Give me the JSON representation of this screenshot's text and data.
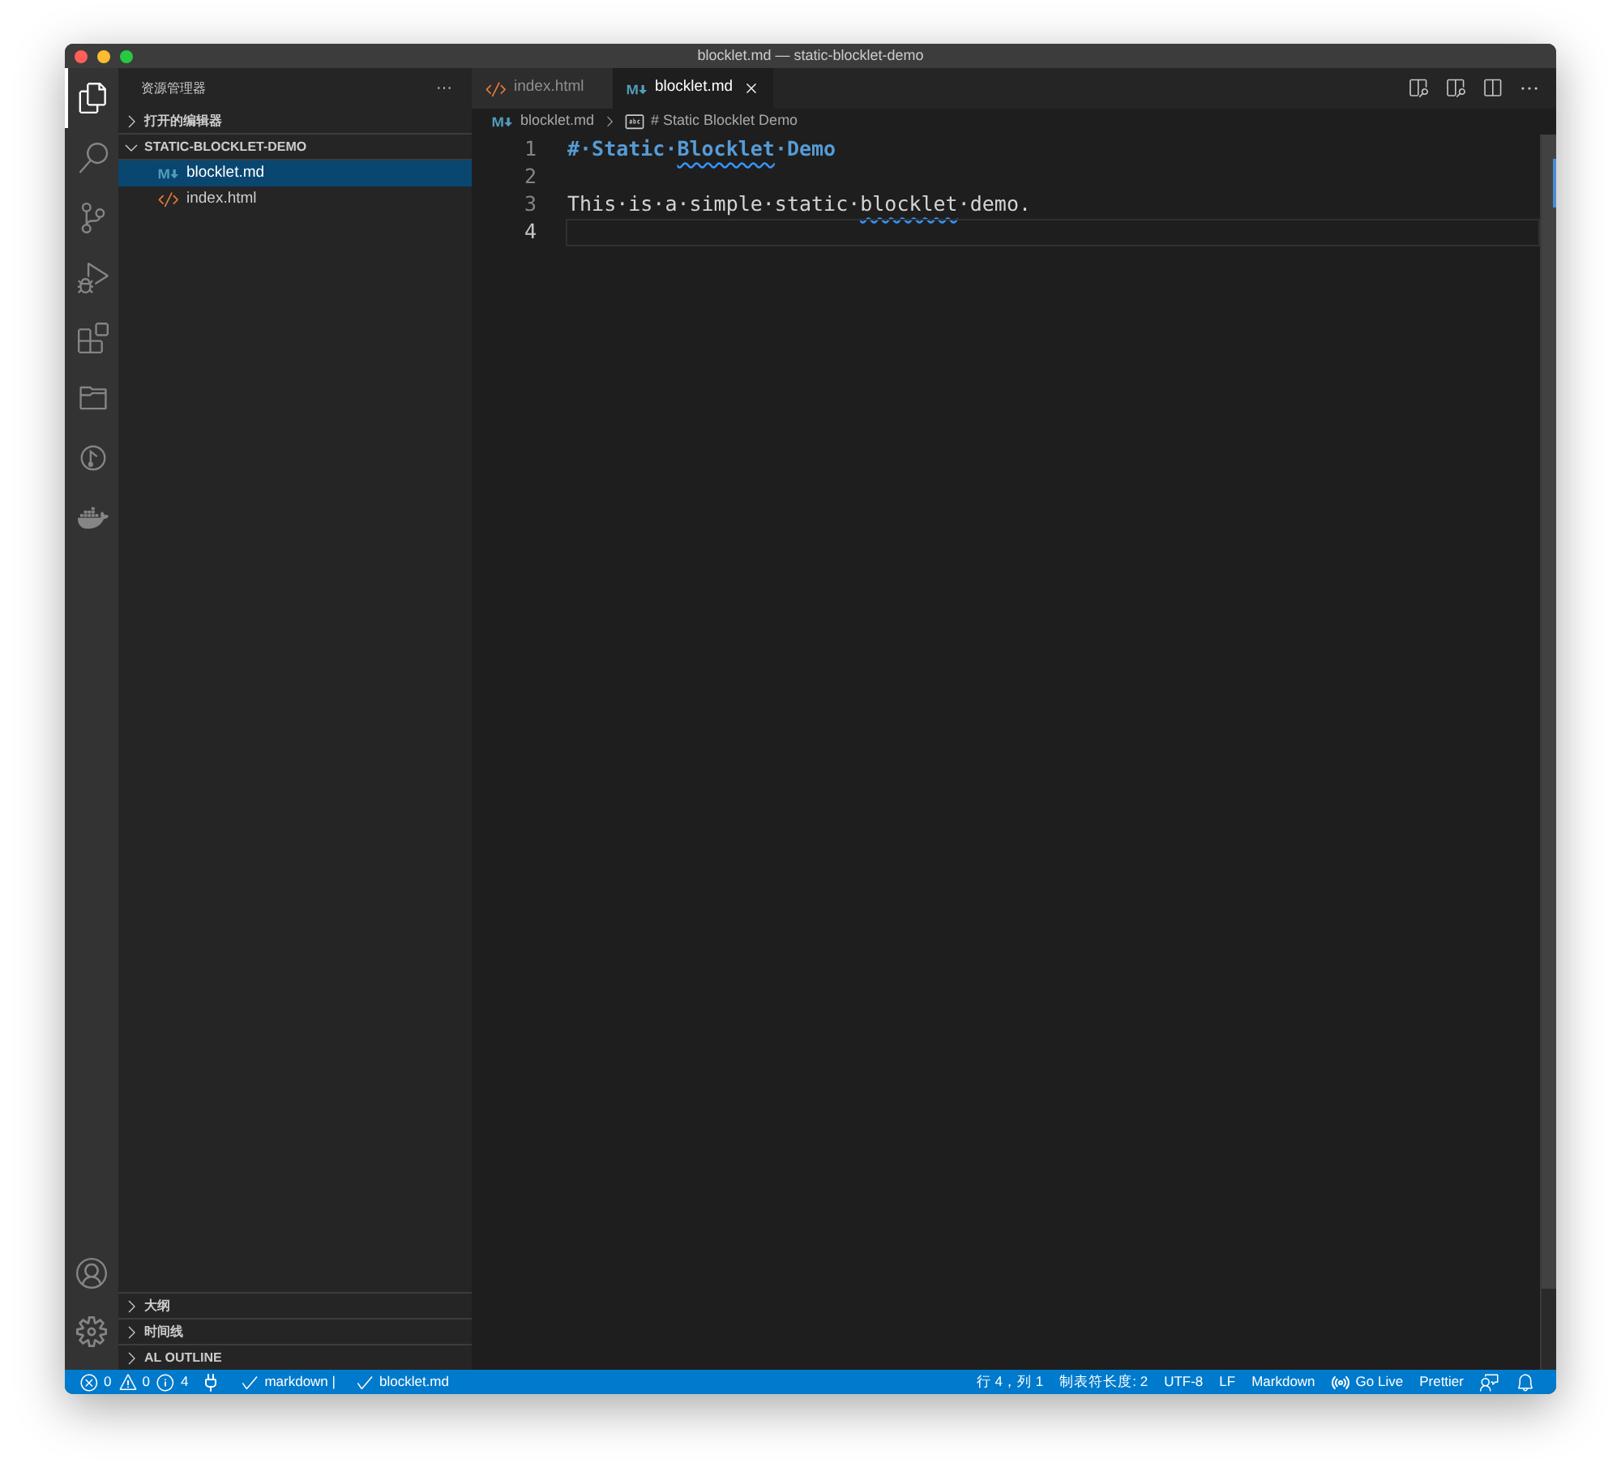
{
  "window": {
    "title": "blocklet.md — static-blocklet-demo"
  },
  "activity_bar": [
    {
      "kind": "files",
      "selected": true
    },
    {
      "kind": "search",
      "selected": false
    },
    {
      "kind": "source-control",
      "selected": false
    },
    {
      "kind": "run-debug",
      "selected": false
    },
    {
      "kind": "extensions",
      "selected": false
    },
    {
      "kind": "folder",
      "selected": false
    },
    {
      "kind": "branch-circle",
      "selected": false
    },
    {
      "kind": "docker",
      "selected": false
    }
  ],
  "activity_bar_bottom": [
    {
      "kind": "account"
    },
    {
      "kind": "settings"
    }
  ],
  "sidebar": {
    "title": "资源管理器",
    "more": "···",
    "sections": [
      {
        "label": "打开的编辑器",
        "expanded": false
      },
      {
        "label": "STATIC-BLOCKLET-DEMO",
        "expanded": true,
        "items": [
          {
            "name": "blocklet.md",
            "kind": "markdown",
            "selected": true
          },
          {
            "name": "index.html",
            "kind": "html",
            "selected": false
          }
        ]
      }
    ],
    "bottom_sections": [
      {
        "label": "大纲",
        "expanded": false
      },
      {
        "label": "时间线",
        "expanded": false
      },
      {
        "label": "AL OUTLINE",
        "expanded": false
      }
    ]
  },
  "tabs": [
    {
      "label": "index.html",
      "kind": "html",
      "selected": false
    },
    {
      "label": "blocklet.md",
      "kind": "markdown",
      "selected": true
    }
  ],
  "breadcrumbs": [
    {
      "label": "blocklet.md",
      "kind": "markdown"
    },
    {
      "label": "# Static Blocklet Demo",
      "kind": "symbol"
    }
  ],
  "editor": {
    "lines": [
      {
        "number": "1",
        "current": false,
        "segments": [
          {
            "text": "#·Static·",
            "kind": "heading",
            "squiggle": false
          },
          {
            "text": "Blocklet",
            "kind": "heading",
            "squiggle": true
          },
          {
            "text": "·Demo",
            "kind": "heading",
            "squiggle": false
          }
        ]
      },
      {
        "number": "2",
        "current": false
      },
      {
        "number": "3",
        "current": false,
        "segments": [
          {
            "text": "This·is·a·simple·static·",
            "kind": "plain",
            "squiggle": false
          },
          {
            "text": "blocklet",
            "kind": "plain",
            "squiggle": true
          },
          {
            "text": "·demo.",
            "kind": "plain",
            "squiggle": false
          }
        ]
      },
      {
        "number": "4",
        "current": true
      }
    ]
  },
  "status_bar": {
    "left": [
      {
        "kind": "error",
        "text": "0"
      },
      {
        "kind": "warning",
        "text": "0"
      },
      {
        "kind": "info",
        "text": "4"
      },
      {
        "kind": "plug"
      },
      {
        "kind": "check",
        "text": "markdown |"
      },
      {
        "kind": "check",
        "text": "blocklet.md"
      }
    ],
    "right": [
      {
        "kind": "text",
        "text": "行 4，列 1"
      },
      {
        "kind": "text",
        "text": "制表符长度: 2"
      },
      {
        "kind": "text",
        "text": "UTF-8"
      },
      {
        "kind": "text",
        "text": "LF"
      },
      {
        "kind": "text",
        "text": "Markdown"
      },
      {
        "kind": "broadcast",
        "text": "Go Live"
      },
      {
        "kind": "text",
        "text": "Prettier"
      },
      {
        "kind": "feedback"
      },
      {
        "kind": "bell"
      }
    ]
  }
}
